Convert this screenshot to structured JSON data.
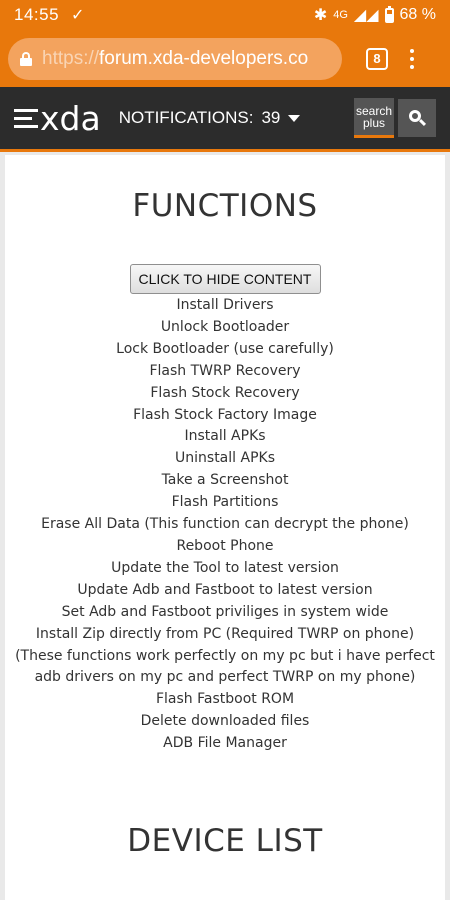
{
  "status_bar": {
    "time": "14:55",
    "network": "4G",
    "battery": "68 %"
  },
  "browser": {
    "url_scheme": "https://",
    "url_host": "forum.xda-developers.co",
    "tab_count": "8"
  },
  "xda_header": {
    "logo": "xda",
    "notifications_label": "NOTIFICATIONS:",
    "notifications_count": "39",
    "search_plus_line1": "search",
    "search_plus_line2": "plus"
  },
  "content": {
    "functions_title": "FUNCTIONS",
    "toggle_button": "CLICK TO HIDE CONTENT",
    "functions": [
      "Install Drivers",
      "Unlock Bootloader",
      "Lock Bootloader (use carefully)",
      "Flash TWRP Recovery",
      "Flash Stock Recovery",
      "Flash Stock Factory Image",
      "Install APKs",
      "Uninstall APKs",
      "Take a Screenshot",
      "Flash Partitions",
      "Erase All Data (This function can decrypt the phone)",
      "Reboot Phone",
      "Update the Tool to latest version",
      "Update Adb and Fastboot to latest version",
      "Set Adb and Fastboot priviliges in system wide",
      "Install Zip directly from PC (Required TWRP on phone) (These functions work perfectly on my pc but i have perfect adb drivers on my pc and perfect TWRP on my phone)",
      "Flash Fastboot ROM",
      "Delete downloaded files",
      "ADB File Manager"
    ],
    "device_list_title": "DEVICE LIST"
  }
}
